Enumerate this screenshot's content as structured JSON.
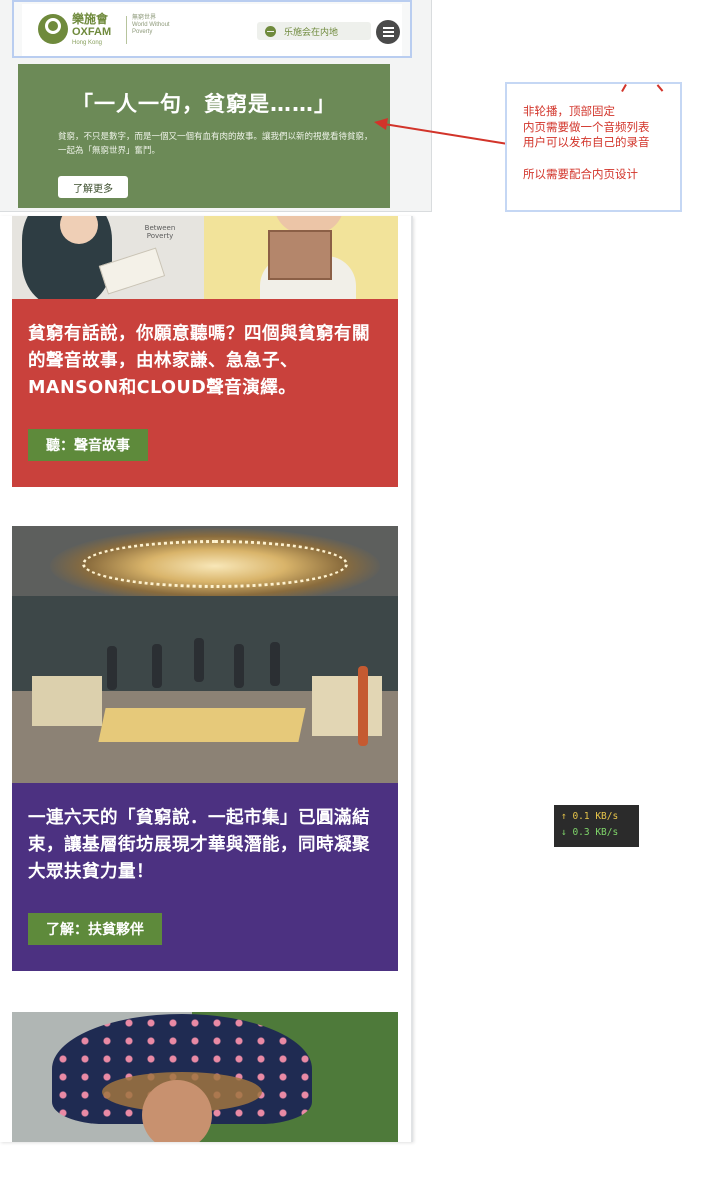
{
  "header": {
    "logo_cn": "樂施會",
    "logo_en": "OXFAM",
    "logo_region": "Hong Kong",
    "tagline": "無窮世界 World Without Poverty",
    "region_label": "乐施会在内地",
    "menu_icon": "hamburger-icon"
  },
  "hero": {
    "title": "「一人一句，貧窮是……」",
    "description": "貧窮，不只是數字，而是一個又一個有血有肉的故事。讓我們以新的視覺看待貧窮，一起為「無窮世界」奮鬥。",
    "button_label": "了解更多"
  },
  "annotation": {
    "lines": [
      "非轮播，顶部固定",
      "内页需要做一个音频列表",
      "用户可以发布自己的录音",
      "所以需要配合内页设计"
    ],
    "color": "#d2342a"
  },
  "cards": [
    {
      "image_mark": "Between Poverty",
      "text": "貧窮有話說，你願意聽嗎？四個與貧窮有關的聲音故事，由林家謙、急急子、MANSON和CLOUD聲音演繹。",
      "button_label": "聽：聲音故事",
      "bg_color": "#c9413c"
    },
    {
      "text": "一連六天的「貧窮說．一起市集」已圓滿結束，讓基層街坊展現才華與潛能，同時凝聚大眾扶貧力量！",
      "button_label": "了解：扶貧夥伴",
      "bg_color": "#4c3181"
    },
    {
      "image_desc_icon": "photo-umbrella"
    }
  ],
  "speed_widget": {
    "upload": "↑ 0.1 KB/s",
    "download": "↓ 0.3 KB/s"
  }
}
